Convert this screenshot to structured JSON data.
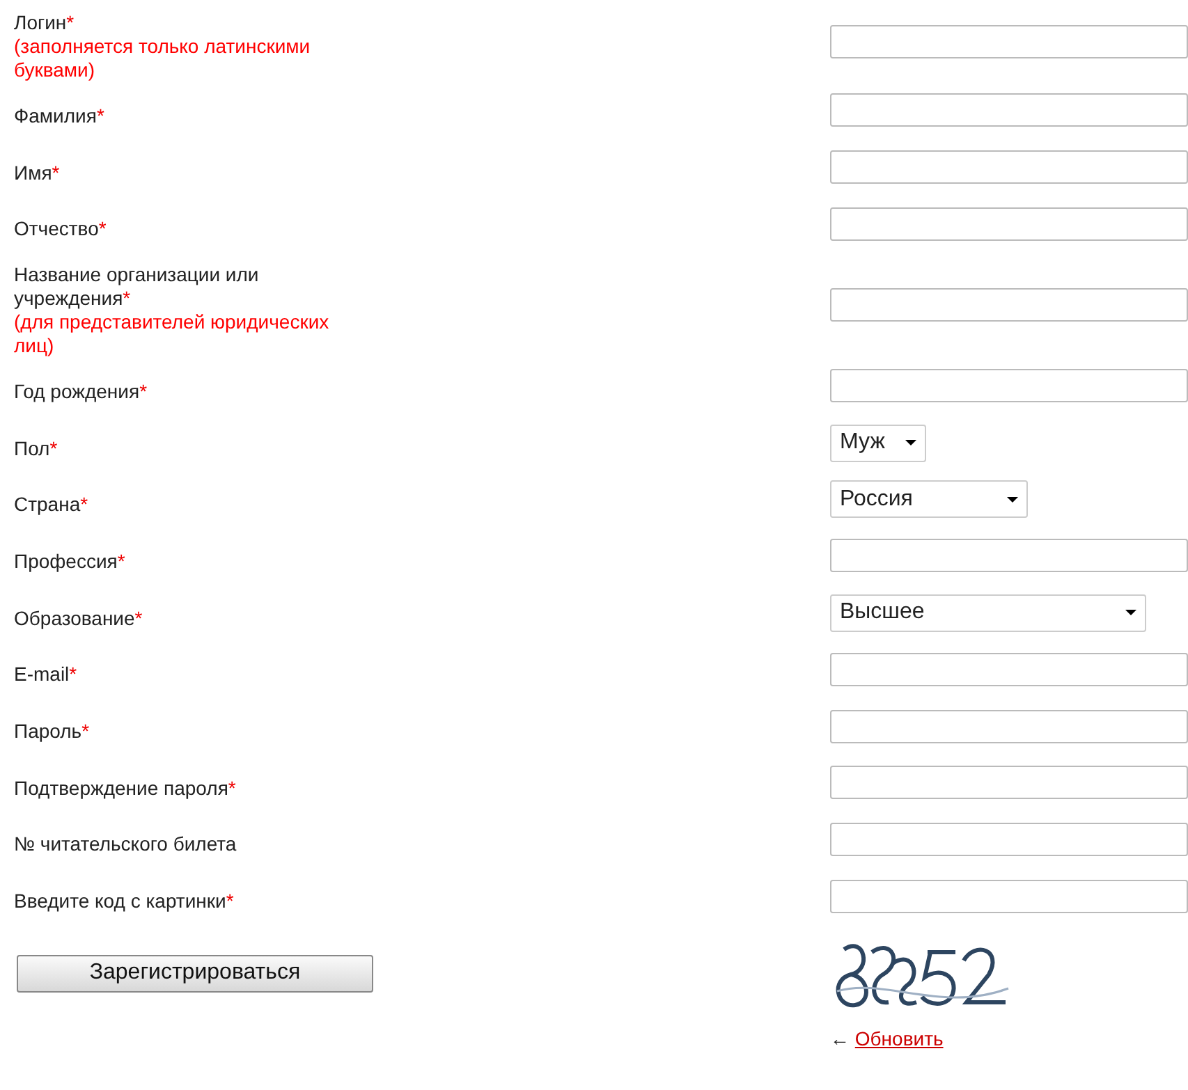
{
  "fields": [
    {
      "label": "Логин",
      "asterisk": "*",
      "note": "(заполняется только латинскими буквами)",
      "kind": "text"
    },
    {
      "label": "Фамилия",
      "asterisk": "*",
      "kind": "text"
    },
    {
      "label": "Имя",
      "asterisk": "*",
      "kind": "text"
    },
    {
      "label": "Отчество",
      "asterisk": "*",
      "kind": "text"
    },
    {
      "label": "Название организации или учреждения",
      "asterisk": "*",
      "note": "(для представителей юридических лиц)",
      "kind": "text"
    },
    {
      "label": "Год рождения",
      "asterisk": "*",
      "kind": "text"
    },
    {
      "label": "Пол",
      "asterisk": "*",
      "kind": "select",
      "value": "Муж"
    },
    {
      "label": "Страна",
      "asterisk": "*",
      "kind": "select",
      "value": "Россия"
    },
    {
      "label": "Профессия",
      "asterisk": "*",
      "kind": "text"
    },
    {
      "label": "Образование",
      "asterisk": "*",
      "kind": "select",
      "value": "Высшее"
    },
    {
      "label": "E-mail",
      "asterisk": "*",
      "kind": "text"
    },
    {
      "label": "Пароль",
      "asterisk": "*",
      "kind": "text"
    },
    {
      "label": "Подтверждение пароля",
      "asterisk": "*",
      "kind": "text"
    },
    {
      "label": "№ читательского билета",
      "kind": "text"
    },
    {
      "label": "Введите код с картинки",
      "asterisk": "*",
      "kind": "text"
    }
  ],
  "submit_button": "Зарегистрироваться",
  "captcha": {
    "kind": "picture",
    "refresh_arrow": "←",
    "refresh_link": "Обновить"
  }
}
